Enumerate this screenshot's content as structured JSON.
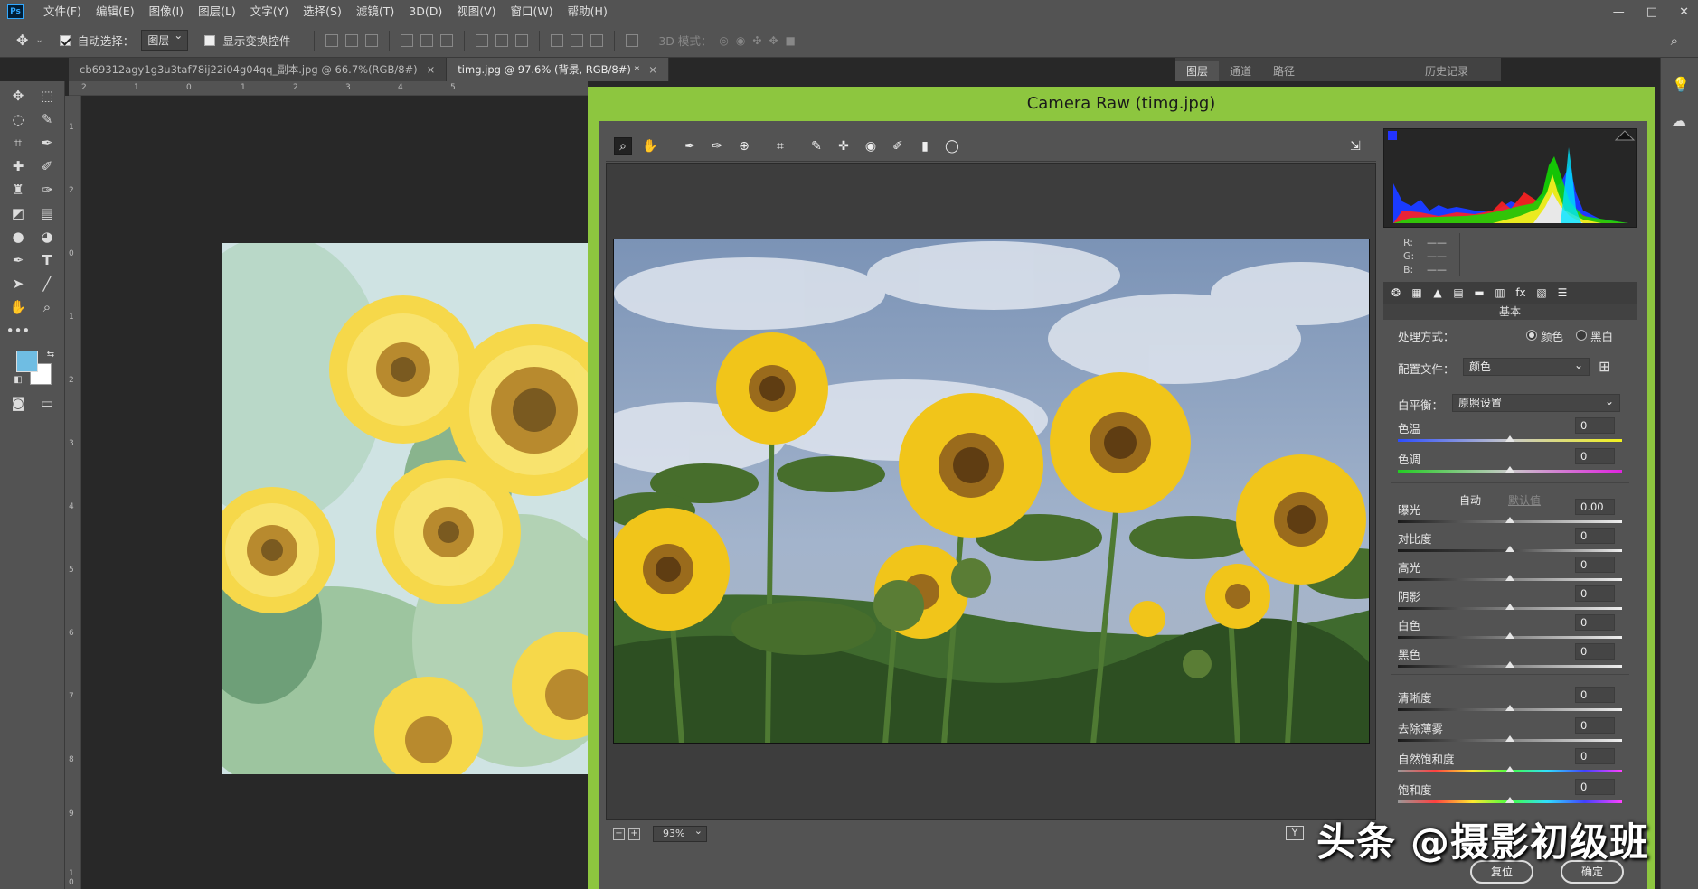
{
  "menubar": {
    "logo": "Ps",
    "items": [
      "文件(F)",
      "编辑(E)",
      "图像(I)",
      "图层(L)",
      "文字(Y)",
      "选择(S)",
      "滤镜(T)",
      "3D(D)",
      "视图(V)",
      "窗口(W)",
      "帮助(H)"
    ],
    "window_controls": [
      "—",
      "□",
      "✕"
    ]
  },
  "options": {
    "auto_select_label": "自动选择：",
    "auto_select_value": "图层",
    "show_transform_label": "显示变换控件",
    "mode_3d_label": "3D 模式："
  },
  "tabs": [
    {
      "label": "cb69312agy1g3u3taf78ij22i04g04qq_副本.jpg @ 66.7%(RGB/8#)",
      "close": "×"
    },
    {
      "label": "timg.jpg @ 97.6% (背景, RGB/8#) *",
      "close": "×"
    }
  ],
  "right_tabs": [
    "图层",
    "通道",
    "路径",
    "历史记录"
  ],
  "ruler": {
    "top": [
      "2",
      "1",
      "0",
      "1",
      "2",
      "3",
      "4",
      "5"
    ],
    "left": [
      "1",
      "2",
      "0",
      "1",
      "2",
      "3",
      "4",
      "5",
      "6",
      "7",
      "8",
      "9",
      "1",
      "0"
    ]
  },
  "camera_raw": {
    "title": "Camera Raw (timg.jpg)",
    "rgb": {
      "r_label": "R:",
      "g_label": "G:",
      "b_label": "B:",
      "r": "——",
      "g": "——",
      "b": "——"
    },
    "panel_title": "基本",
    "treatment_label": "处理方式：",
    "treatment_color": "颜色",
    "treatment_bw": "黑白",
    "profile_label": "配置文件：",
    "profile_value": "颜色",
    "wb_label": "白平衡：",
    "wb_value": "原照设置",
    "auto_label": "自动",
    "default_label": "默认值",
    "sliders": [
      {
        "label": "色温",
        "value": "0"
      },
      {
        "label": "色调",
        "value": "0"
      },
      {
        "label": "曝光",
        "value": "0.00"
      },
      {
        "label": "对比度",
        "value": "0"
      },
      {
        "label": "高光",
        "value": "0"
      },
      {
        "label": "阴影",
        "value": "0"
      },
      {
        "label": "白色",
        "value": "0"
      },
      {
        "label": "黑色",
        "value": "0"
      },
      {
        "label": "清晰度",
        "value": "0"
      },
      {
        "label": "去除薄雾",
        "value": "0"
      },
      {
        "label": "自然饱和度",
        "value": "0"
      },
      {
        "label": "饱和度",
        "value": "0"
      }
    ],
    "zoom_value": "93%",
    "y_label": "Y",
    "reset_label": "复位",
    "ok_label": "确定"
  },
  "watermark": "头条 @摄影初级班",
  "colors": {
    "dialog_border": "#8dc63f",
    "foreground": "#6fbde3",
    "background": "#ffffff"
  }
}
